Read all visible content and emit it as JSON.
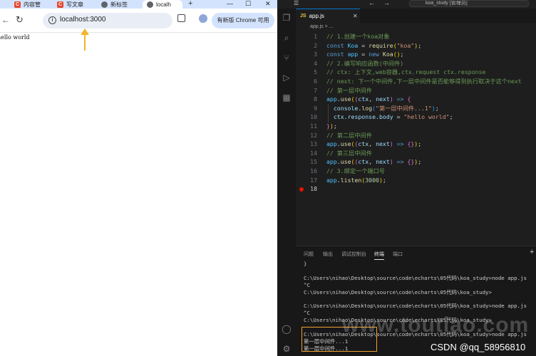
{
  "browser": {
    "tabs": [
      {
        "label": "内容管",
        "icon": "csdn-icon"
      },
      {
        "label": "写文章",
        "icon": "csdn-icon"
      },
      {
        "label": "新标签",
        "icon": "globe-icon"
      },
      {
        "label": "localh",
        "icon": "globe-icon",
        "active": true
      }
    ],
    "new_tab_label": "+",
    "window_controls": {
      "minimize": "—",
      "maximize": "☐",
      "close": "✕"
    },
    "url": "localhost:3000",
    "update_button_label": "有新版 Chrome 可用",
    "page_text": "hello world"
  },
  "vscode": {
    "title": "koa_study [管理员]",
    "nav_back": "←",
    "nav_forward": "→",
    "tab_label": "app.js",
    "tab_icon_label": "JS",
    "breadcrumb": "app.js > ...",
    "active_line": 18,
    "breakpoint_line": 18,
    "code_lines": [
      {
        "n": "1",
        "segs": [
          [
            "c-com",
            "// 1.创建一个koa对象"
          ]
        ]
      },
      {
        "n": "2",
        "segs": [
          [
            "c-kw",
            "const "
          ],
          [
            "c-var",
            "Koa"
          ],
          [
            "c-pun",
            " = "
          ],
          [
            "c-fn",
            "require"
          ],
          [
            "c-br1",
            "("
          ],
          [
            "c-str",
            "\"koa\""
          ],
          [
            "c-br1",
            ")"
          ],
          [
            "c-pun",
            ";"
          ]
        ]
      },
      {
        "n": "3",
        "segs": [
          [
            "c-kw",
            "const "
          ],
          [
            "c-var",
            "app"
          ],
          [
            "c-pun",
            " = "
          ],
          [
            "c-kw",
            "new "
          ],
          [
            "c-fn",
            "Koa"
          ],
          [
            "c-br1",
            "()"
          ],
          [
            "c-pun",
            ";"
          ]
        ]
      },
      {
        "n": "4",
        "segs": [
          [
            "c-com",
            "// 2.编写响应函数(中间件)"
          ]
        ]
      },
      {
        "n": "5",
        "segs": [
          [
            "c-com",
            "// ctx: 上下文,web容器,ctx.request ctx.response"
          ]
        ]
      },
      {
        "n": "6",
        "segs": [
          [
            "c-com",
            "// next: 下一个中间件,下一层中间件是否能够得到执行取决于这个next"
          ]
        ]
      },
      {
        "n": "7",
        "segs": [
          [
            "c-com",
            "// 第一层中间件"
          ]
        ]
      },
      {
        "n": "8",
        "segs": [
          [
            "c-var",
            "app"
          ],
          [
            "c-pun",
            "."
          ],
          [
            "c-fn",
            "use"
          ],
          [
            "c-br1",
            "("
          ],
          [
            "c-br2",
            "("
          ],
          [
            "c-par",
            "ctx"
          ],
          [
            "c-pun",
            ", "
          ],
          [
            "c-par",
            "next"
          ],
          [
            "c-br2",
            ")"
          ],
          [
            "c-kw",
            " => "
          ],
          [
            "c-br2",
            "{"
          ]
        ]
      },
      {
        "n": "9",
        "segs": [
          [
            "c-pun",
            "  "
          ],
          [
            "c-par",
            "console"
          ],
          [
            "c-pun",
            "."
          ],
          [
            "c-fn",
            "log"
          ],
          [
            "c-br3",
            "("
          ],
          [
            "c-str",
            "\"第一层中间件...1\""
          ],
          [
            "c-br3",
            ")"
          ],
          [
            "c-pun",
            ";"
          ]
        ]
      },
      {
        "n": "10",
        "segs": [
          [
            "c-pun",
            "  "
          ],
          [
            "c-par",
            "ctx"
          ],
          [
            "c-pun",
            "."
          ],
          [
            "c-par",
            "response"
          ],
          [
            "c-pun",
            "."
          ],
          [
            "c-par",
            "body"
          ],
          [
            "c-pun",
            " = "
          ],
          [
            "c-str",
            "\"hello world\""
          ],
          [
            "c-pun",
            ";"
          ]
        ]
      },
      {
        "n": "11",
        "segs": [
          [
            "c-br2",
            "}"
          ],
          [
            "c-br1",
            ")"
          ],
          [
            "c-pun",
            ";"
          ]
        ]
      },
      {
        "n": "12",
        "segs": [
          [
            "c-com",
            "// 第二层中间件"
          ]
        ]
      },
      {
        "n": "13",
        "segs": [
          [
            "c-var",
            "app"
          ],
          [
            "c-pun",
            "."
          ],
          [
            "c-fn",
            "use"
          ],
          [
            "c-br1",
            "("
          ],
          [
            "c-br2",
            "("
          ],
          [
            "c-par",
            "ctx"
          ],
          [
            "c-pun",
            ", "
          ],
          [
            "c-par",
            "next"
          ],
          [
            "c-br2",
            ")"
          ],
          [
            "c-kw",
            " => "
          ],
          [
            "c-br2",
            "{}"
          ],
          [
            "c-br1",
            ")"
          ],
          [
            "c-pun",
            ";"
          ]
        ]
      },
      {
        "n": "14",
        "segs": [
          [
            "c-com",
            "// 第三层中间件"
          ]
        ]
      },
      {
        "n": "15",
        "segs": [
          [
            "c-var",
            "app"
          ],
          [
            "c-pun",
            "."
          ],
          [
            "c-fn",
            "use"
          ],
          [
            "c-br1",
            "("
          ],
          [
            "c-br2",
            "("
          ],
          [
            "c-par",
            "ctx"
          ],
          [
            "c-pun",
            ", "
          ],
          [
            "c-par",
            "next"
          ],
          [
            "c-br2",
            ")"
          ],
          [
            "c-kw",
            " => "
          ],
          [
            "c-br2",
            "{}"
          ],
          [
            "c-br1",
            ")"
          ],
          [
            "c-pun",
            ";"
          ]
        ]
      },
      {
        "n": "16",
        "segs": [
          [
            "c-com",
            "// 3.绑定一个端口号"
          ]
        ]
      },
      {
        "n": "17",
        "segs": [
          [
            "c-var",
            "app"
          ],
          [
            "c-pun",
            "."
          ],
          [
            "c-fn",
            "listen"
          ],
          [
            "c-br1",
            "("
          ],
          [
            "c-num",
            "3000"
          ],
          [
            "c-br1",
            ")"
          ],
          [
            "c-pun",
            ";"
          ]
        ]
      },
      {
        "n": "18",
        "segs": []
      }
    ],
    "panel_tabs": [
      "问题",
      "输出",
      "调试控制台",
      "终端",
      "端口"
    ],
    "panel_active_tab": "终端",
    "panel_add": "+",
    "terminal_lines": [
      "}",
      "",
      "C:\\Users\\nihao\\Desktop\\source\\code\\echarts\\05代码\\koa_study>node app.js",
      "^C",
      "C:\\Users\\nihao\\Desktop\\source\\code\\echarts\\05代码\\koa_study>",
      "",
      "C:\\Users\\nihao\\Desktop\\source\\code\\echarts\\05代码\\koa_study>node app.js",
      "^C",
      "C:\\Users\\nihao\\Desktop\\source\\code\\echarts\\05代码\\koa_study>",
      "",
      "C:\\Users\\nihao\\Desktop\\source\\code\\echarts\\05代码\\koa_study>node app.js",
      "第一层中间件...1",
      "第一层中间件...1"
    ]
  },
  "watermark": "www.toutiao.com",
  "csdn_credit": "CSDN @qq_58956810",
  "colors": {
    "highlight_box": "#f0a030",
    "arrow": "#f0b429",
    "breakpoint": "#e51400",
    "accent": "#0078d4"
  }
}
